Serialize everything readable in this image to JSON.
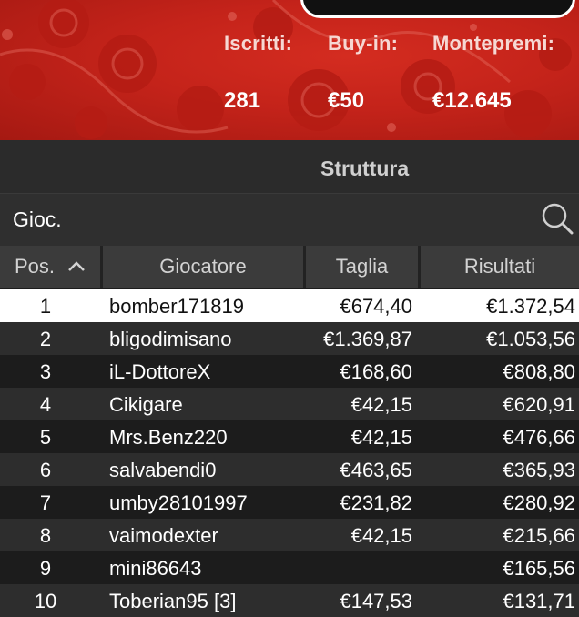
{
  "header": {
    "stats": [
      {
        "label": "Iscritti:",
        "value": "281"
      },
      {
        "label": "Buy-in:",
        "value": "€50"
      },
      {
        "label": "Montepremi:",
        "value": "€12.645"
      }
    ]
  },
  "section": {
    "title": "Struttura"
  },
  "search": {
    "label": "Gioc.",
    "icon": "search-icon"
  },
  "table": {
    "columns": [
      "Pos.",
      "Giocatore",
      "Taglia",
      "Risultati"
    ],
    "sort_icon": "chevron-up-icon",
    "rows": [
      {
        "pos": "1",
        "player": "bomber171819",
        "size": "€674,40",
        "result": "€1.372,54"
      },
      {
        "pos": "2",
        "player": "bligodimisano",
        "size": "€1.369,87",
        "result": "€1.053,56"
      },
      {
        "pos": "3",
        "player": "iL-DottoreX",
        "size": "€168,60",
        "result": "€808,80"
      },
      {
        "pos": "4",
        "player": "Cikigare",
        "size": "€42,15",
        "result": "€620,91"
      },
      {
        "pos": "5",
        "player": "Mrs.Benz220",
        "size": "€42,15",
        "result": "€476,66"
      },
      {
        "pos": "6",
        "player": "salvabendi0",
        "size": "€463,65",
        "result": "€365,93"
      },
      {
        "pos": "7",
        "player": "umby28101997",
        "size": "€231,82",
        "result": "€280,92"
      },
      {
        "pos": "8",
        "player": "vaimodexter",
        "size": "€42,15",
        "result": "€215,66"
      },
      {
        "pos": "9",
        "player": "mini86643",
        "size": "",
        "result": "€165,56"
      },
      {
        "pos": "10",
        "player": "Toberian95 [3]",
        "size": "€147,53",
        "result": "€131,71"
      }
    ]
  },
  "colors": {
    "banner": "#c4231a",
    "selected_row": "#ffffff",
    "alt_row": "#2d2d2d",
    "base_row": "#1c1c1c"
  }
}
